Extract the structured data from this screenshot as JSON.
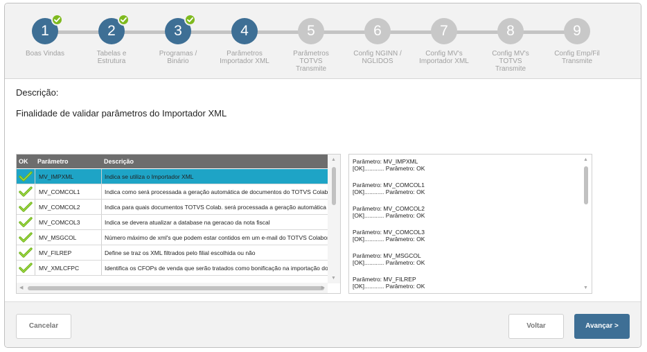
{
  "wizard": {
    "steps": [
      {
        "number": "1",
        "label_lines": [
          "Boas Vindas"
        ],
        "state": "done"
      },
      {
        "number": "2",
        "label_lines": [
          "Tabelas e",
          "Estrutura"
        ],
        "state": "done"
      },
      {
        "number": "3",
        "label_lines": [
          "Programas /",
          "Binário"
        ],
        "state": "done"
      },
      {
        "number": "4",
        "label_lines": [
          "Parâmetros",
          "Importador XML"
        ],
        "state": "current"
      },
      {
        "number": "5",
        "label_lines": [
          "Parâmetros",
          "TOTVS",
          "Transmite"
        ],
        "state": "todo"
      },
      {
        "number": "6",
        "label_lines": [
          "Config NGINN /",
          "NGLIDOS"
        ],
        "state": "todo"
      },
      {
        "number": "7",
        "label_lines": [
          "Config MV's",
          "Importador XML"
        ],
        "state": "todo"
      },
      {
        "number": "8",
        "label_lines": [
          "Config MV's",
          "TOTVS",
          "Transmite"
        ],
        "state": "todo"
      },
      {
        "number": "9",
        "label_lines": [
          "Config Emp/Fil",
          "Transmite"
        ],
        "state": "todo"
      }
    ]
  },
  "description": {
    "title": "Descrição:",
    "text": "Finalidade de validar parâmetros do Importador XML"
  },
  "table": {
    "columns": [
      "OK",
      "Parâmetro",
      "Descrição"
    ],
    "rows": [
      {
        "param": "MV_IMPXML",
        "desc": "Indica se utiliza o Importador XML",
        "selected": true
      },
      {
        "param": "MV_COMCOL1",
        "desc": "Indica como será processada a geração automática de documentos do TOTVS Colab.",
        "selected": false
      },
      {
        "param": "MV_COMCOL2",
        "desc": "Indica para quais documentos TOTVS Colab. será processada a geração automática",
        "selected": false
      },
      {
        "param": "MV_COMCOL3",
        "desc": "Indica se devera atualizar a database na geracao da nota fiscal",
        "selected": false
      },
      {
        "param": "MV_MSGCOL",
        "desc": "Número máximo de xml's que podem estar contidos em um e-mail do TOTVS Colaboração",
        "selected": false
      },
      {
        "param": "MV_FILREP",
        "desc": "Define se traz os XML filtrados pelo filial escolhida ou não",
        "selected": false
      },
      {
        "param": "MV_XMLCFPC",
        "desc": "Identifica os CFOPs de venda que serão tratados como bonificação na importação do XML",
        "selected": false
      }
    ]
  },
  "log": {
    "entries": [
      {
        "line1": "Parâmetro: MV_IMPXML",
        "line2": "[OK]............ Parâmetro: OK"
      },
      {
        "line1": "Parâmetro: MV_COMCOL1",
        "line2": "[OK]............ Parâmetro: OK"
      },
      {
        "line1": "Parâmetro: MV_COMCOL2",
        "line2": "[OK]............ Parâmetro: OK"
      },
      {
        "line1": "Parâmetro: MV_COMCOL3",
        "line2": "[OK]............ Parâmetro: OK"
      },
      {
        "line1": "Parâmetro: MV_MSGCOL",
        "line2": "[OK]............ Parâmetro: OK"
      },
      {
        "line1": "Parâmetro: MV_FILREP",
        "line2": "[OK]............ Parâmetro: OK"
      }
    ]
  },
  "footer": {
    "cancel_label": "Cancelar",
    "back_label": "Voltar",
    "next_label": "Avançar >"
  },
  "colors": {
    "accent": "#3e6f95",
    "selection": "#1ea4c6",
    "check": "#7fba1f"
  },
  "icons": {
    "step_done": "checkmark-badge-icon",
    "row_ok": "green-check-icon"
  }
}
